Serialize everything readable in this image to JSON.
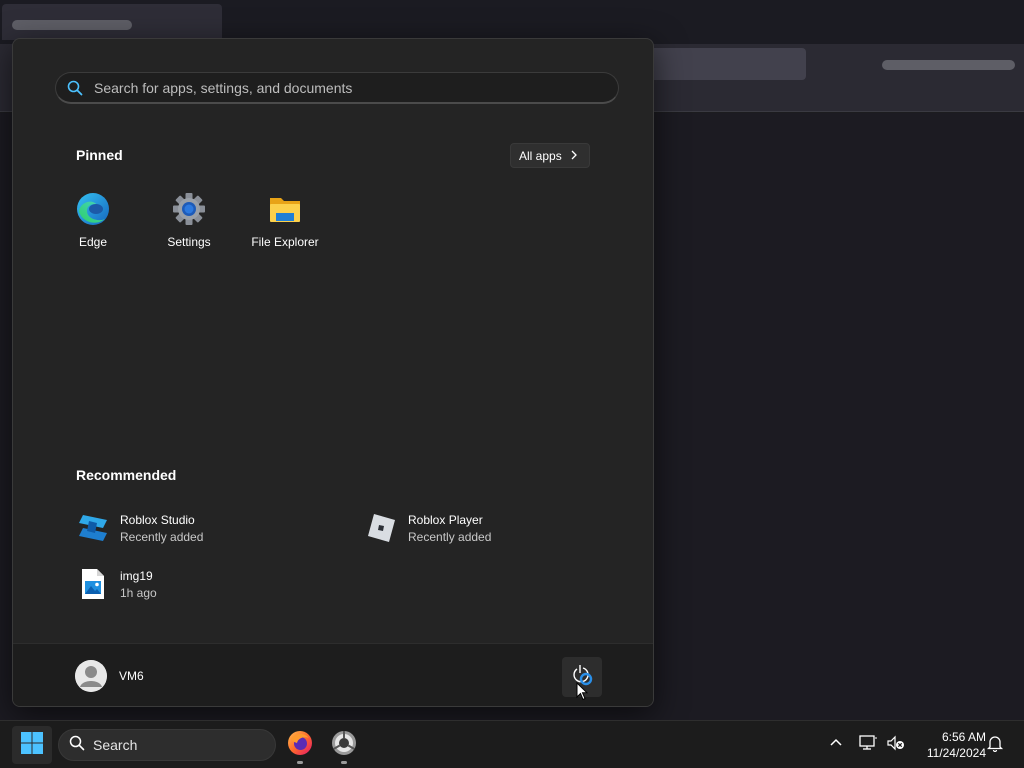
{
  "start_menu": {
    "search_placeholder": "Search for apps, settings, and documents",
    "pinned_title": "Pinned",
    "all_apps_label": "All apps",
    "pinned_apps": [
      {
        "label": "Edge",
        "icon": "edge-icon"
      },
      {
        "label": "Settings",
        "icon": "settings-gear-icon"
      },
      {
        "label": "File Explorer",
        "icon": "folder-icon"
      }
    ],
    "recommended_title": "Recommended",
    "recommended": [
      {
        "name": "Roblox Studio",
        "subtitle": "Recently added",
        "icon": "roblox-studio-icon"
      },
      {
        "name": "Roblox Player",
        "subtitle": "Recently added",
        "icon": "roblox-player-icon"
      },
      {
        "name": "img19",
        "subtitle": "1h ago",
        "icon": "image-file-icon"
      }
    ],
    "user_name": "VM6",
    "power_icon": "power-icon"
  },
  "taskbar": {
    "search_label": "Search",
    "apps": [
      {
        "name": "Firefox",
        "icon": "firefox-icon"
      },
      {
        "name": "Chrome-like browser",
        "icon": "browser-icon"
      }
    ],
    "time": "6:56 AM",
    "date": "11/24/2024"
  },
  "colors": {
    "accent": "#0078d4",
    "start_bg": "#242424",
    "taskbar_bg": "#1c1c1c"
  }
}
